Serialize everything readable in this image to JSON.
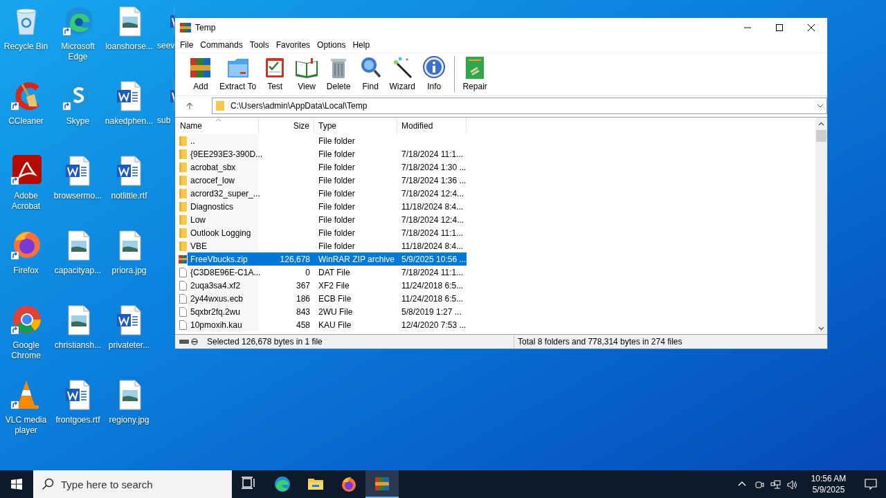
{
  "desktop_icons": [
    {
      "label": "Recycle Bin",
      "kind": "recycle"
    },
    {
      "label": "CCleaner",
      "kind": "ccleaner"
    },
    {
      "label": "Adobe Acrobat",
      "kind": "acrobat"
    },
    {
      "label": "Firefox",
      "kind": "firefox"
    },
    {
      "label": "Google Chrome",
      "kind": "chrome"
    },
    {
      "label": "VLC media player",
      "kind": "vlc"
    },
    {
      "label": "Microsoft Edge",
      "kind": "edge"
    },
    {
      "label": "Skype",
      "kind": "skype"
    },
    {
      "label": "browsermo...",
      "kind": "word"
    },
    {
      "label": "capacityap...",
      "kind": "image"
    },
    {
      "label": "christiansh...",
      "kind": "image"
    },
    {
      "label": "frontgoes.rtf",
      "kind": "word"
    },
    {
      "label": "loanshorse...",
      "kind": "image"
    },
    {
      "label": "nakedphen...",
      "kind": "word"
    },
    {
      "label": "notlittle.rtf",
      "kind": "word"
    },
    {
      "label": "priora.jpg",
      "kind": "image"
    },
    {
      "label": "privateter...",
      "kind": "word"
    },
    {
      "label": "regiony.jpg",
      "kind": "image"
    },
    {
      "label": "seev",
      "kind": "word"
    },
    {
      "label": "sub",
      "kind": "word"
    }
  ],
  "window": {
    "title": "Temp",
    "menu": [
      "File",
      "Commands",
      "Tools",
      "Favorites",
      "Options",
      "Help"
    ],
    "toolbar": [
      {
        "label": "Add",
        "kind": "add"
      },
      {
        "label": "Extract To",
        "kind": "extract"
      },
      {
        "label": "Test",
        "kind": "test"
      },
      {
        "label": "View",
        "kind": "view"
      },
      {
        "label": "Delete",
        "kind": "delete"
      },
      {
        "label": "Find",
        "kind": "find"
      },
      {
        "label": "Wizard",
        "kind": "wizard"
      },
      {
        "label": "Info",
        "kind": "info"
      },
      {
        "label": "Repair",
        "kind": "repair"
      }
    ],
    "address": "C:\\Users\\admin\\AppData\\Local\\Temp",
    "columns": [
      "Name",
      "Size",
      "Type",
      "Modified"
    ],
    "rows": [
      {
        "name": "..",
        "size": "",
        "type": "File folder",
        "modified": "",
        "kind": "folder",
        "selected": false
      },
      {
        "name": "{9EE293E3-390D...",
        "size": "",
        "type": "File folder",
        "modified": "7/18/2024 11:1...",
        "kind": "folder",
        "selected": false
      },
      {
        "name": "acrobat_sbx",
        "size": "",
        "type": "File folder",
        "modified": "7/18/2024 1:30 ...",
        "kind": "folder",
        "selected": false
      },
      {
        "name": "acrocef_low",
        "size": "",
        "type": "File folder",
        "modified": "7/18/2024 1:36 ...",
        "kind": "folder",
        "selected": false
      },
      {
        "name": "acrord32_super_...",
        "size": "",
        "type": "File folder",
        "modified": "7/18/2024 12:4...",
        "kind": "folder",
        "selected": false
      },
      {
        "name": "Diagnostics",
        "size": "",
        "type": "File folder",
        "modified": "11/18/2024 8:4...",
        "kind": "folder",
        "selected": false
      },
      {
        "name": "Low",
        "size": "",
        "type": "File folder",
        "modified": "7/18/2024 12:4...",
        "kind": "folder",
        "selected": false
      },
      {
        "name": "Outlook Logging",
        "size": "",
        "type": "File folder",
        "modified": "7/18/2024 11:1...",
        "kind": "folder",
        "selected": false
      },
      {
        "name": "VBE",
        "size": "",
        "type": "File folder",
        "modified": "11/18/2024 8:4...",
        "kind": "folder",
        "selected": false
      },
      {
        "name": "FreeVbucks.zip",
        "size": "126,678",
        "type": "WinRAR ZIP archive",
        "modified": "5/9/2025 10:56 ...",
        "kind": "zip",
        "selected": true
      },
      {
        "name": "{C3D8E96E-C1A...",
        "size": "0",
        "type": "DAT File",
        "modified": "7/18/2024 11:1...",
        "kind": "file",
        "selected": false
      },
      {
        "name": "2uqa3sa4.xf2",
        "size": "367",
        "type": "XF2 File",
        "modified": "11/24/2018 6:5...",
        "kind": "file",
        "selected": false
      },
      {
        "name": "2y44wxus.ecb",
        "size": "186",
        "type": "ECB File",
        "modified": "11/24/2018 6:5...",
        "kind": "file",
        "selected": false
      },
      {
        "name": "5qxbr2fq.2wu",
        "size": "843",
        "type": "2WU File",
        "modified": "5/8/2019 1:27 ...",
        "kind": "file",
        "selected": false
      },
      {
        "name": "10pmoxih.kau",
        "size": "458",
        "type": "KAU File",
        "modified": "12/4/2020 7:53 ...",
        "kind": "file",
        "selected": false
      }
    ],
    "status_left": "Selected 126,678 bytes in 1 file",
    "status_right": "Total 8 folders and 778,314 bytes in 274 files"
  },
  "taskbar": {
    "search_placeholder": "Type here to search",
    "apps": [
      {
        "kind": "taskview",
        "selected": false
      },
      {
        "kind": "edge",
        "selected": false
      },
      {
        "kind": "explorer",
        "selected": false
      },
      {
        "kind": "firefox",
        "selected": false
      },
      {
        "kind": "winrar",
        "selected": true
      }
    ],
    "time": "10:56 AM",
    "date": "5/9/2025"
  }
}
